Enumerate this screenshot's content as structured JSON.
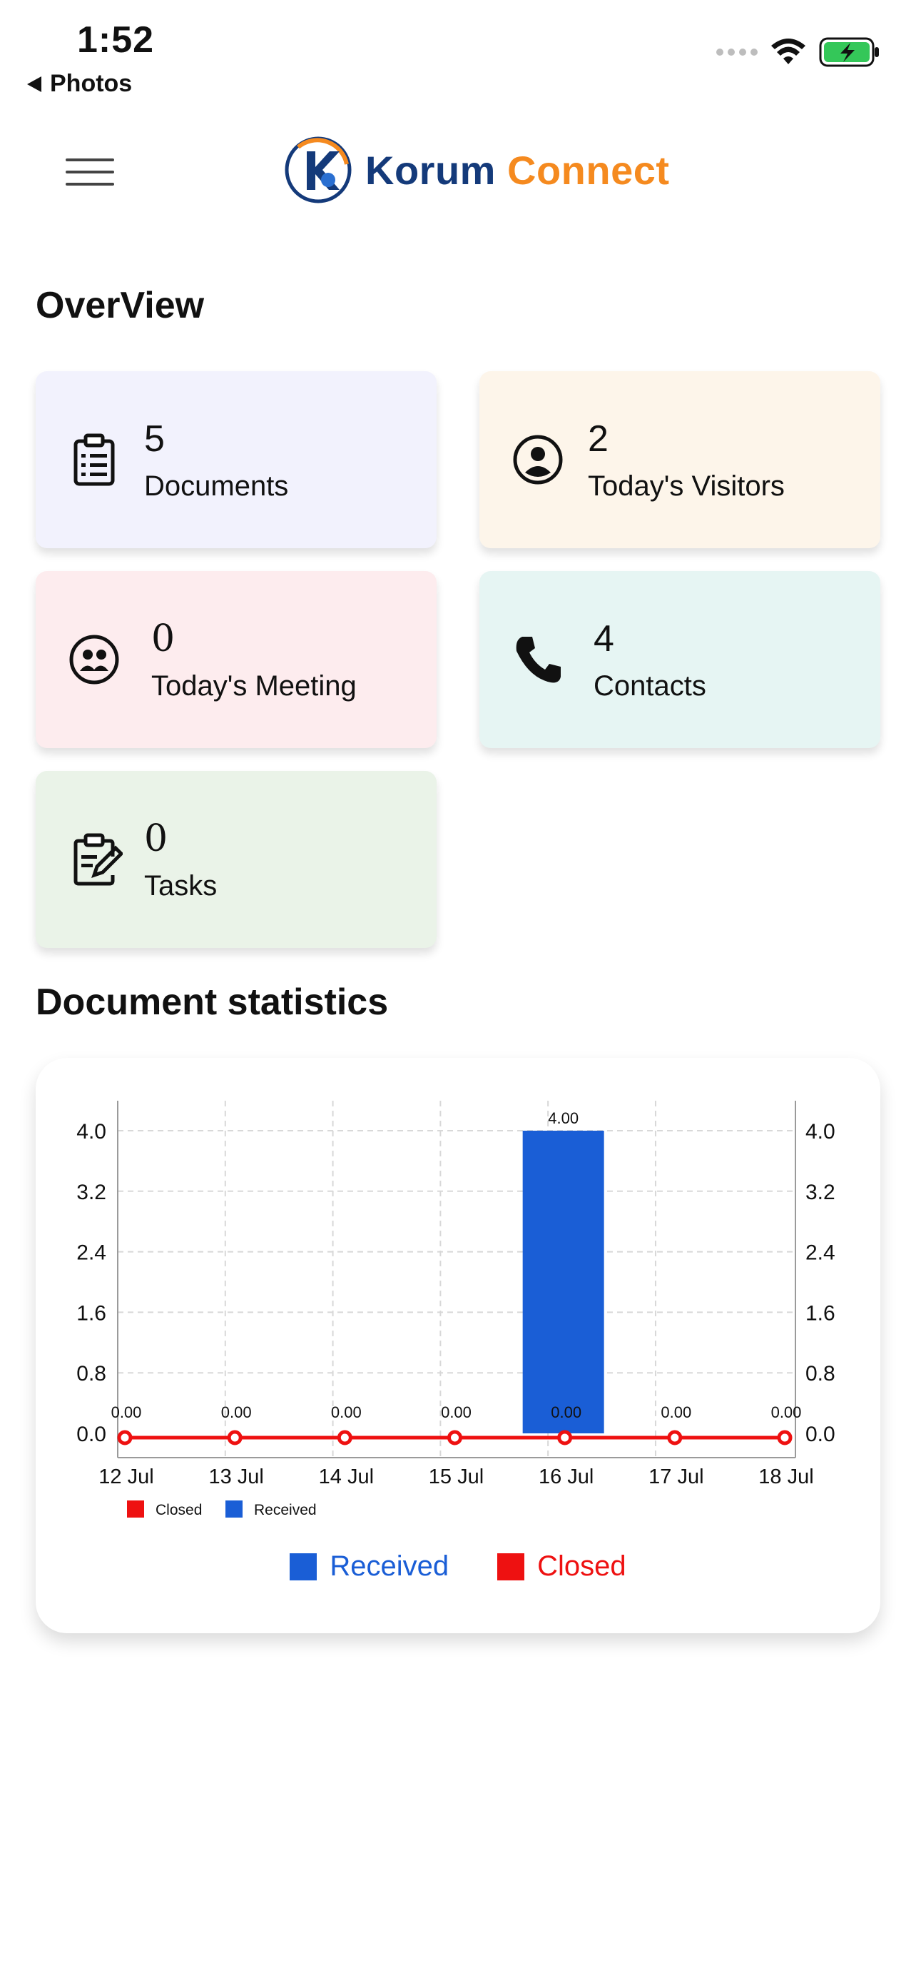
{
  "status_bar": {
    "time": "1:52",
    "back_label": "Photos",
    "icons": [
      "signal-icon",
      "wifi-icon",
      "battery-charging-icon"
    ]
  },
  "header": {
    "brand_first": "Korum",
    "brand_second": "Connect",
    "brand_colors": {
      "primary": "#143a7a",
      "accent": "#f58a1f"
    },
    "menu_icon": "hamburger-menu-icon"
  },
  "overview": {
    "title": "OverView",
    "cards": [
      {
        "value": "5",
        "label": "Documents",
        "icon": "clipboard-list-icon",
        "bg": "#f2f2fd"
      },
      {
        "value": "2",
        "label": "Today's Visitors",
        "icon": "account-circle-icon",
        "bg": "#fdf5ea"
      },
      {
        "value": "0",
        "label": "Today's Meeting",
        "icon": "group-icon",
        "bg": "#fdecee"
      },
      {
        "value": "4",
        "label": "Contacts",
        "icon": "phone-icon",
        "bg": "#e6f5f3"
      },
      {
        "value": "0",
        "label": "Tasks",
        "icon": "clipboard-edit-icon",
        "bg": "#eaf3e8"
      }
    ]
  },
  "stats": {
    "title": "Document statistics",
    "legend": [
      {
        "label": "Received",
        "color": "#1a5ed6"
      },
      {
        "label": "Closed",
        "color": "#ee1111"
      }
    ]
  },
  "chart_data": {
    "type": "bar",
    "categories": [
      "12 Jul",
      "13 Jul",
      "14 Jul",
      "15 Jul",
      "16 Jul",
      "17 Jul",
      "18 Jul"
    ],
    "series": [
      {
        "name": "Received",
        "type": "bar",
        "color": "#1a5ed6",
        "values": [
          0,
          0,
          0,
          0,
          4,
          0,
          0
        ]
      },
      {
        "name": "Closed",
        "type": "line",
        "color": "#ee1111",
        "values": [
          0,
          0,
          0,
          0,
          0,
          0,
          0
        ]
      }
    ],
    "data_labels": [
      "0.00",
      "0.00",
      "0.00",
      "0.00",
      "0.00",
      "0.00",
      "0.00"
    ],
    "bar_label": "4.00",
    "yticks": [
      "0.0",
      "0.8",
      "1.6",
      "2.4",
      "3.2",
      "4.0"
    ],
    "ylim": [
      0,
      4
    ],
    "grid": true,
    "inner_legend": [
      {
        "label": "Closed",
        "color": "#ee1111"
      },
      {
        "label": "Received",
        "color": "#1a5ed6"
      }
    ],
    "legend_position": "bottom-left"
  }
}
